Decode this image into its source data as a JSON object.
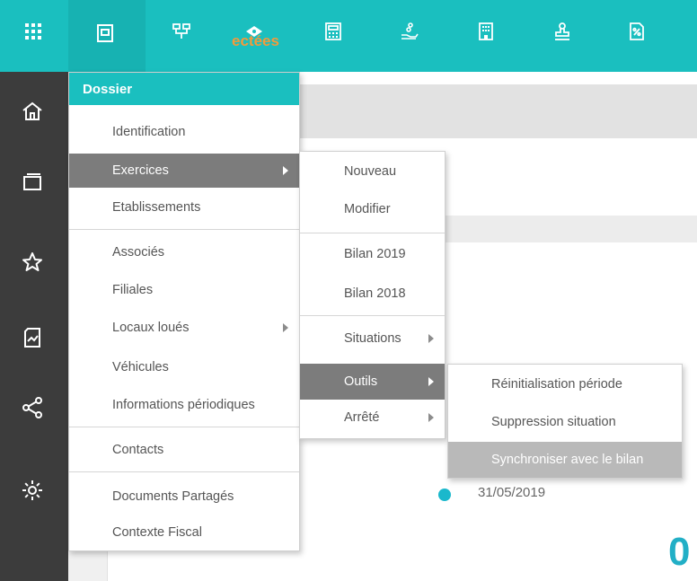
{
  "main": {
    "header_title": "ectées",
    "date": "31/05/2019",
    "big_number": "0"
  },
  "menu_dossier": {
    "title": "Dossier",
    "items": [
      {
        "label": "Identification"
      },
      {
        "label": "Exercices"
      },
      {
        "label": "Etablissements"
      },
      {
        "label": "Associés"
      },
      {
        "label": "Filiales"
      },
      {
        "label": "Locaux loués"
      },
      {
        "label": "Véhicules"
      },
      {
        "label": "Informations périodiques"
      },
      {
        "label": "Contacts"
      },
      {
        "label": "Documents Partagés"
      },
      {
        "label": "Contexte Fiscal"
      }
    ]
  },
  "menu_exercices": {
    "items": [
      {
        "label": "Nouveau"
      },
      {
        "label": "Modifier"
      },
      {
        "label": "Bilan 2019"
      },
      {
        "label": "Bilan 2018"
      },
      {
        "label": "Situations"
      },
      {
        "label": "Outils"
      },
      {
        "label": "Arrêté"
      }
    ]
  },
  "menu_outils": {
    "items": [
      {
        "label": "Réinitialisation période"
      },
      {
        "label": "Suppression situation"
      },
      {
        "label": "Synchroniser avec le bilan"
      }
    ]
  },
  "colors": {
    "accent": "#1abfbf",
    "sidebar": "#3c3c3c",
    "selected": "#7c7c7c",
    "hover": "#b9b9b9",
    "header_title": "#f39a3a",
    "date_dot": "#1ab8cc"
  },
  "icons": {
    "top": [
      "apps-grid-icon",
      "folder-doc-icon",
      "org-chart-icon",
      "money-stack-icon",
      "calculator-icon",
      "hand-coins-icon",
      "building-icon",
      "stamp-icon",
      "percent-doc-icon"
    ],
    "side": [
      "home-icon",
      "window-icon",
      "star-icon",
      "chart-doc-icon",
      "share-icon",
      "settings-icon"
    ]
  }
}
